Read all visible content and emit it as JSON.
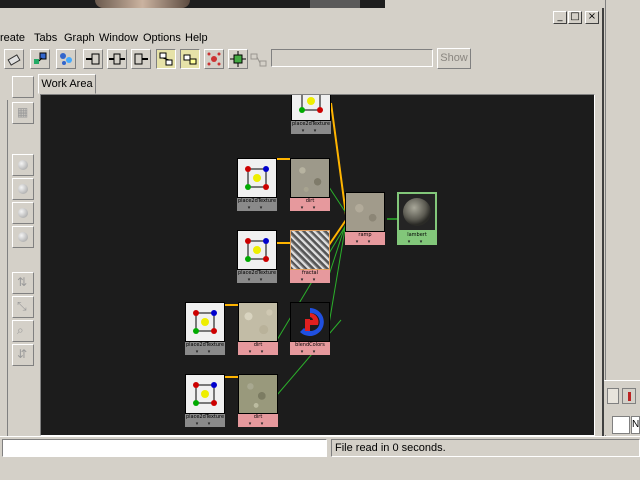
{
  "window": {
    "controls": {
      "minimize": "_",
      "maximize": "□",
      "close": "×"
    }
  },
  "menubar": {
    "items": [
      "Create",
      "Tabs",
      "Graph",
      "Window",
      "Options",
      "Help"
    ]
  },
  "toolbar": {
    "show_label": "Show",
    "icons": [
      "eraser-icon",
      "shading-group-icon",
      "input-connections-icon",
      "input-output-connections-icon",
      "output-connections-icon",
      "rearrange-graph-icon",
      "graph-materials-icon",
      "clear-graph-icon",
      "node-layout-icon",
      "disabled-network-icon"
    ]
  },
  "tabs": {
    "work_area": "Work Area"
  },
  "status": {
    "message": "File read in 0 seconds."
  },
  "nodes": {
    "place_top": {
      "label": "place2dTexture",
      "arrows": "▾ ▾"
    },
    "place_1": {
      "label": "place2dTexture",
      "arrows": "▾ ▾"
    },
    "place_2": {
      "label": "place2dTexture",
      "arrows": "▾ ▾"
    },
    "place_3": {
      "label": "place2dTexture",
      "arrows": "▾ ▾"
    },
    "place_4": {
      "label": "place2dTexture",
      "arrows": "▾ ▾"
    },
    "dirt_1": {
      "label": "dirt",
      "arrows": "▾ ▾"
    },
    "fractal": {
      "label": "fractal",
      "arrows": "▾ ▾"
    },
    "dirt_2": {
      "label": "dirt",
      "arrows": "▾ ▾"
    },
    "dirt_3": {
      "label": "dirt",
      "arrows": "▾ ▾"
    },
    "blend": {
      "label": "blendColors",
      "arrows": "▾ ▾"
    },
    "ramp": {
      "label": "ramp",
      "arrows": "▾ ▾"
    },
    "lambert": {
      "label": "lambert",
      "arrows": "▾ ▾"
    }
  }
}
